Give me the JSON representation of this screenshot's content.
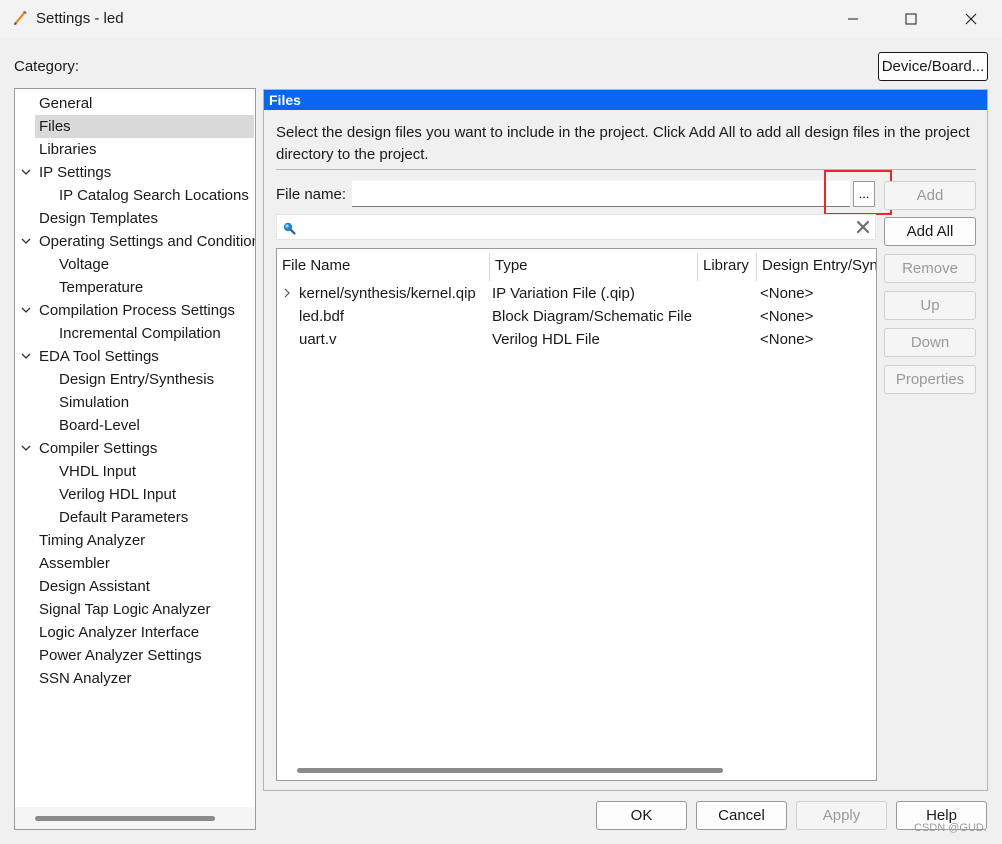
{
  "window": {
    "title": "Settings - led",
    "icon": "settings-app-icon"
  },
  "category": {
    "label": "Category:",
    "device_button": "Device/Board...",
    "items": [
      {
        "label": "General",
        "level": 0,
        "expandable": false,
        "selected": false
      },
      {
        "label": "Files",
        "level": 0,
        "expandable": false,
        "selected": true
      },
      {
        "label": "Libraries",
        "level": 0,
        "expandable": false,
        "selected": false
      },
      {
        "label": "IP Settings",
        "level": 0,
        "expandable": true,
        "selected": false
      },
      {
        "label": "IP Catalog Search Locations",
        "level": 1,
        "expandable": false,
        "selected": false
      },
      {
        "label": "Design Templates",
        "level": 0,
        "expandable": false,
        "selected": false
      },
      {
        "label": "Operating Settings and Conditions",
        "level": 0,
        "expandable": true,
        "selected": false
      },
      {
        "label": "Voltage",
        "level": 1,
        "expandable": false,
        "selected": false
      },
      {
        "label": "Temperature",
        "level": 1,
        "expandable": false,
        "selected": false
      },
      {
        "label": "Compilation Process Settings",
        "level": 0,
        "expandable": true,
        "selected": false
      },
      {
        "label": "Incremental Compilation",
        "level": 1,
        "expandable": false,
        "selected": false
      },
      {
        "label": "EDA Tool Settings",
        "level": 0,
        "expandable": true,
        "selected": false
      },
      {
        "label": "Design Entry/Synthesis",
        "level": 1,
        "expandable": false,
        "selected": false
      },
      {
        "label": "Simulation",
        "level": 1,
        "expandable": false,
        "selected": false
      },
      {
        "label": "Board-Level",
        "level": 1,
        "expandable": false,
        "selected": false
      },
      {
        "label": "Compiler Settings",
        "level": 0,
        "expandable": true,
        "selected": false
      },
      {
        "label": "VHDL Input",
        "level": 1,
        "expandable": false,
        "selected": false
      },
      {
        "label": "Verilog HDL Input",
        "level": 1,
        "expandable": false,
        "selected": false
      },
      {
        "label": "Default Parameters",
        "level": 1,
        "expandable": false,
        "selected": false
      },
      {
        "label": "Timing Analyzer",
        "level": 0,
        "expandable": false,
        "selected": false
      },
      {
        "label": "Assembler",
        "level": 0,
        "expandable": false,
        "selected": false
      },
      {
        "label": "Design Assistant",
        "level": 0,
        "expandable": false,
        "selected": false
      },
      {
        "label": "Signal Tap Logic Analyzer",
        "level": 0,
        "expandable": false,
        "selected": false
      },
      {
        "label": "Logic Analyzer Interface",
        "level": 0,
        "expandable": false,
        "selected": false
      },
      {
        "label": "Power Analyzer Settings",
        "level": 0,
        "expandable": false,
        "selected": false
      },
      {
        "label": "SSN Analyzer",
        "level": 0,
        "expandable": false,
        "selected": false
      }
    ]
  },
  "files": {
    "header": "Files",
    "description": "Select the design files you want to include in the project. Click Add All to add all design files in the project directory to the project.",
    "file_name_label": "File name:",
    "file_name_value": "",
    "browse_label": "...",
    "search_value": "",
    "buttons": {
      "add": "Add",
      "add_all": "Add All",
      "remove": "Remove",
      "up": "Up",
      "down": "Down",
      "properties": "Properties"
    },
    "columns": [
      "File Name",
      "Type",
      "Library",
      "Design Entry/Synthesis Tool"
    ],
    "rows": [
      {
        "file": "kernel/synthesis/kernel.qip",
        "type": "IP Variation File (.qip)",
        "library": "",
        "tool": "<None>",
        "expandable": true
      },
      {
        "file": "led.bdf",
        "type": "Block Diagram/Schematic File",
        "library": "",
        "tool": "<None>",
        "expandable": false
      },
      {
        "file": "uart.v",
        "type": "Verilog HDL File",
        "library": "",
        "tool": "<None>",
        "expandable": false
      }
    ]
  },
  "footer": {
    "ok": "OK",
    "cancel": "Cancel",
    "apply": "Apply",
    "help": "Help"
  },
  "watermark": "CSDN @GUD.",
  "colors": {
    "header_blue": "#0a66f0",
    "highlight_red": "#e8282e",
    "selected_row": "#d9d9d9"
  }
}
